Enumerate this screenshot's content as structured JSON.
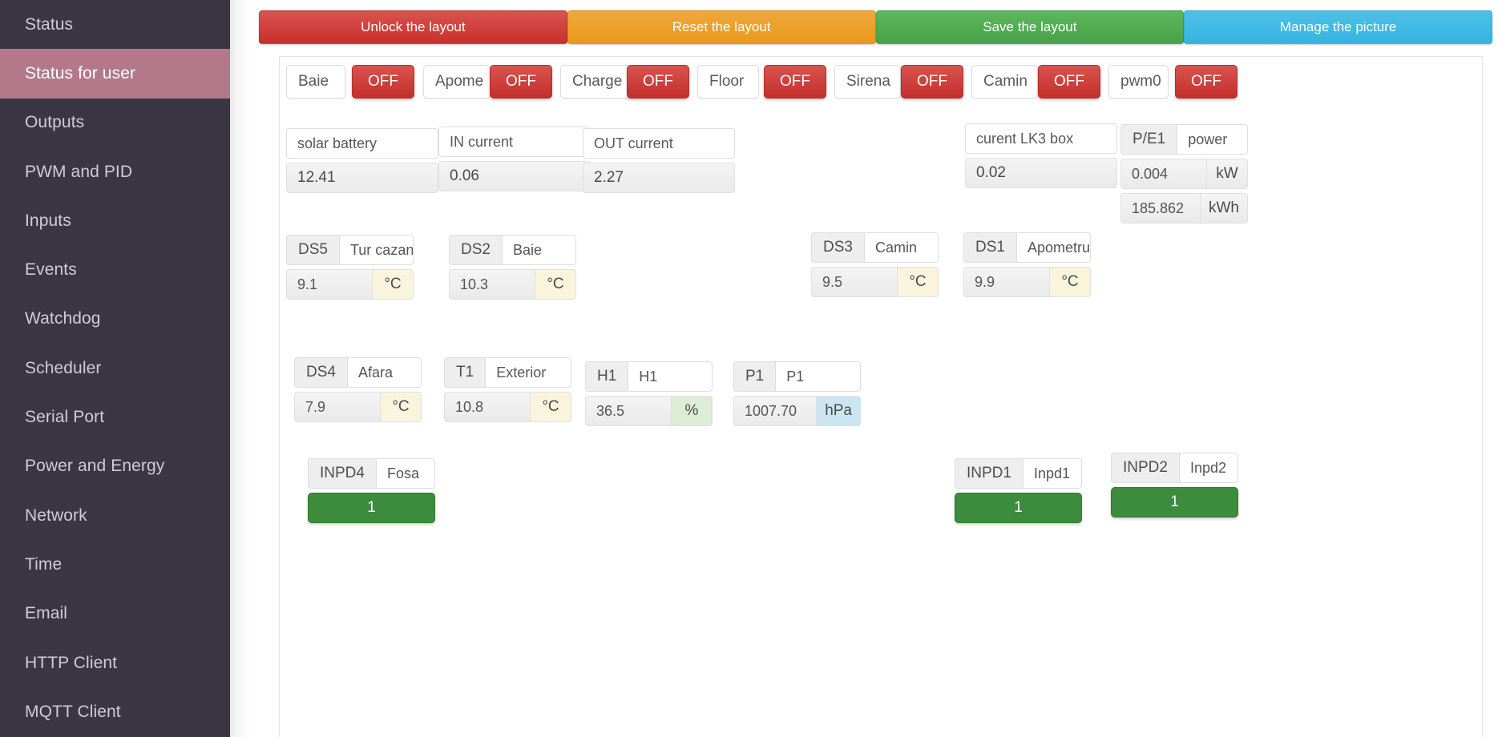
{
  "sidebar": {
    "items": [
      {
        "label": "Status",
        "active": false
      },
      {
        "label": "Status for user",
        "active": true
      },
      {
        "label": "Outputs",
        "active": false
      },
      {
        "label": "PWM and PID",
        "active": false
      },
      {
        "label": "Inputs",
        "active": false
      },
      {
        "label": "Events",
        "active": false
      },
      {
        "label": "Watchdog",
        "active": false
      },
      {
        "label": "Scheduler",
        "active": false
      },
      {
        "label": "Serial Port",
        "active": false
      },
      {
        "label": "Power and Energy",
        "active": false
      },
      {
        "label": "Network",
        "active": false
      },
      {
        "label": "Time",
        "active": false
      },
      {
        "label": "Email",
        "active": false
      },
      {
        "label": "HTTP Client",
        "active": false
      },
      {
        "label": "MQTT Client",
        "active": false
      }
    ]
  },
  "toolbar": {
    "unlock_label": "Unlock the layout",
    "reset_label": "Reset the layout",
    "save_label": "Save the layout",
    "manage_label": "Manage the picture",
    "colors": {
      "unlock": "#d9534f",
      "reset": "#f0a73c",
      "save": "#5cb85c",
      "manage": "#4fc0e8"
    }
  },
  "outputs": [
    {
      "name": "Baie",
      "state": "OFF"
    },
    {
      "name": "Apome",
      "state": "OFF"
    },
    {
      "name": "Charge",
      "state": "OFF"
    },
    {
      "name": "Floor",
      "state": "OFF"
    },
    {
      "name": "Sirena",
      "state": "OFF"
    },
    {
      "name": "Camin",
      "state": "OFF"
    },
    {
      "name": "pwm0",
      "state": "OFF"
    }
  ],
  "analog": [
    {
      "label": "solar battery",
      "value": "12.41"
    },
    {
      "label": "IN current",
      "value": "0.06"
    },
    {
      "label": "OUT current",
      "value": "2.27"
    },
    {
      "label": "curent LK3 box",
      "value": "0.02"
    }
  ],
  "power": {
    "tag": "P/E1",
    "name": "power",
    "power_value": "0.004",
    "power_unit": "kW",
    "energy_value": "185.862",
    "energy_unit": "kWh"
  },
  "sensors_row1": [
    {
      "tag": "DS5",
      "name": "Tur cazan",
      "value": "9.1",
      "unit": "°C",
      "unit_style": "u-temp"
    },
    {
      "tag": "DS2",
      "name": "Baie",
      "value": "10.3",
      "unit": "°C",
      "unit_style": "u-temp"
    },
    {
      "tag": "DS3",
      "name": "Camin",
      "value": "9.5",
      "unit": "°C",
      "unit_style": "u-temp"
    },
    {
      "tag": "DS1",
      "name": "Apometru",
      "value": "9.9",
      "unit": "°C",
      "unit_style": "u-temp"
    }
  ],
  "sensors_row2": [
    {
      "tag": "DS4",
      "name": "Afara",
      "value": "7.9",
      "unit": "°C",
      "unit_style": "u-temp"
    },
    {
      "tag": "T1",
      "name": "Exterior",
      "value": "10.8",
      "unit": "°C",
      "unit_style": "u-temp"
    },
    {
      "tag": "H1",
      "name": "H1",
      "value": "36.5",
      "unit": "%",
      "unit_style": "u-pct"
    },
    {
      "tag": "P1",
      "name": "P1",
      "value": "1007.70",
      "unit": "hPa",
      "unit_style": "u-hpa"
    }
  ],
  "digital_inputs": [
    {
      "tag": "INPD4",
      "name": "Fosa",
      "state": "1"
    },
    {
      "tag": "INPD1",
      "name": "Inpd1",
      "state": "1"
    },
    {
      "tag": "INPD2",
      "name": "Inpd2",
      "state": "1"
    }
  ],
  "colors": {
    "sidebar_bg": "#3a3644",
    "sidebar_active": "#b3798a",
    "off_red": "#c9302c",
    "on_green": "#3d8b3d",
    "temp_unit_bg": "#faf4dd",
    "pct_unit_bg": "#dcecd5",
    "hpa_unit_bg": "#cbe6f2"
  }
}
